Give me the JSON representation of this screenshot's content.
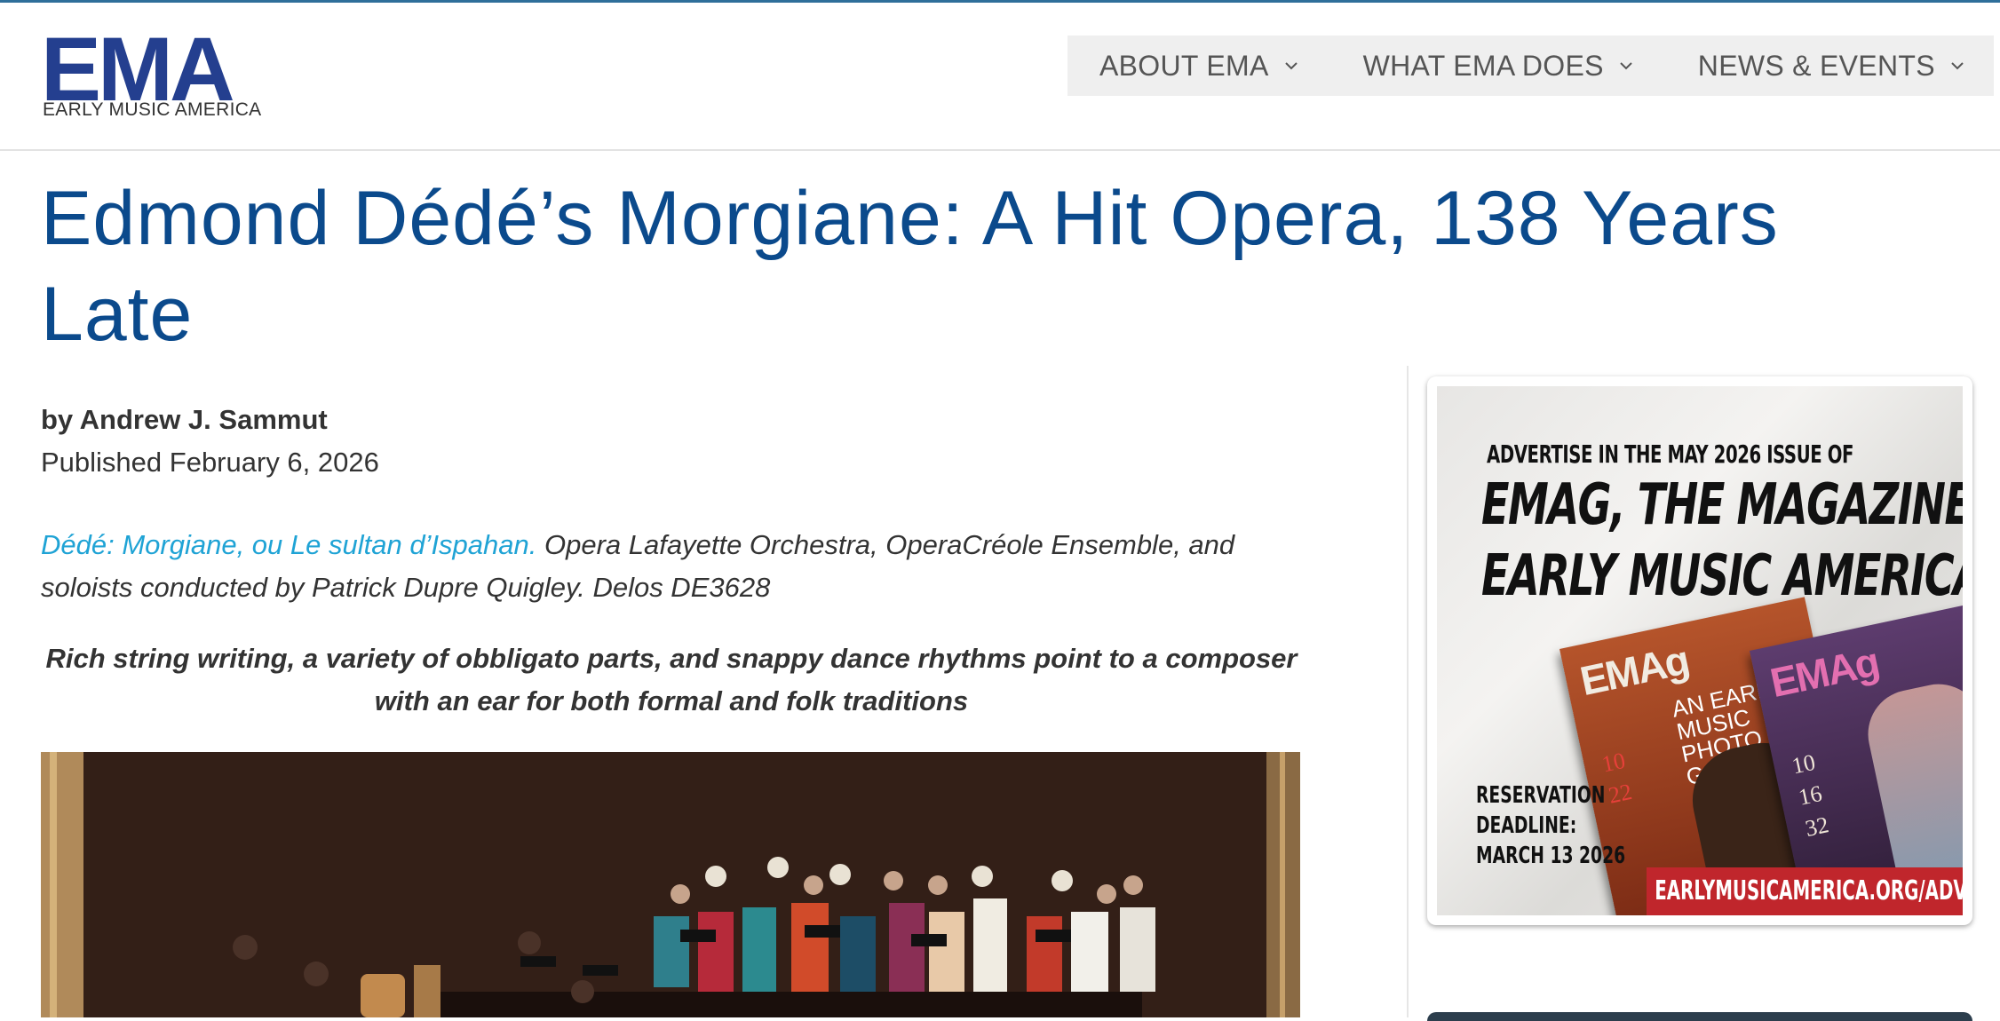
{
  "logo": {
    "mark": "EMA",
    "subtitle": "EARLY MUSIC AMERICA"
  },
  "nav": {
    "items": [
      {
        "label": "ABOUT EMA"
      },
      {
        "label": "WHAT EMA DOES"
      },
      {
        "label": "NEWS & EVENTS"
      }
    ]
  },
  "article": {
    "title": "Edmond Dédé’s Morgiane: A Hit Opera, 138 Years Late",
    "byline": "by Andrew J. Sammut",
    "published": "Published February 6, 2026",
    "credit_link": "Dédé: Morgiane, ou Le sultan d’Ispahan.",
    "credit_rest": " Opera Lafayette Orchestra, OperaCréole Ensemble, and soloists conducted by Patrick Dupre Quigley. Delos DE3628",
    "deck": "Rich string writing, a variety of obbligato parts, and snappy dance rhythms point to a composer with an ear for both formal and folk traditions"
  },
  "ad": {
    "line1": "ADVERTISE IN THE MAY 2026 ISSUE OF",
    "line2a": "EMAG, THE MAGAZINE OF",
    "line2b": "EARLY MUSIC AMERICA",
    "deadline_1": "RESERVATION",
    "deadline_2": "DEADLINE:",
    "deadline_3": "MARCH 13 2026",
    "url": "EARLYMUSICAMERICA.ORG/ADVERTISE",
    "mag1_logo": "EMAg",
    "mag1_caption": "AN EARLY MUSIC PHOTO GALLE",
    "mag2_logo": "EMAg"
  },
  "colors": {
    "title": "#0b4a8c",
    "link": "#1fa3d5",
    "logo": "#243f8f",
    "nav_bg": "#efefef",
    "ad_url_bg": "#c0262c"
  }
}
